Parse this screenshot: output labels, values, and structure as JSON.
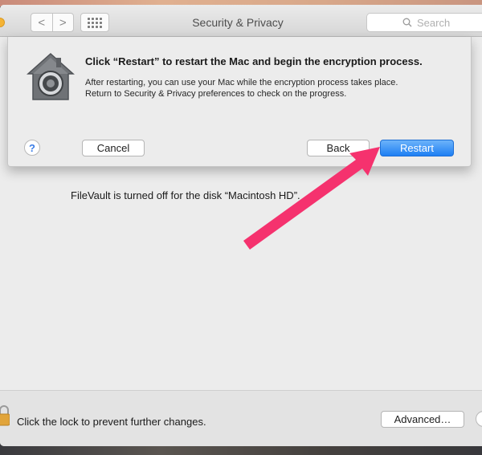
{
  "window": {
    "title": "Security & Privacy",
    "search_placeholder": "Search"
  },
  "toolbar": {
    "back_glyph": "<",
    "forward_glyph": ">",
    "show_all_icon": "grid-icon"
  },
  "sheet": {
    "icon": "filevault-house-icon",
    "heading": "Click “Restart” to restart the Mac and begin the encryption process.",
    "body_line1": "After restarting, you can use your Mac while the encryption process takes place.",
    "body_line2": "Return to Security & Privacy preferences to check on the progress.",
    "help_label": "?",
    "cancel_label": "Cancel",
    "back_label": "Back",
    "restart_label": "Restart"
  },
  "main": {
    "filevault_status": "FileVault is turned off for the disk “Macintosh HD”."
  },
  "footer": {
    "lock_text": "Click the lock to prevent further changes.",
    "advanced_label": "Advanced…"
  },
  "annotation": {
    "arrow_color": "#f5326e",
    "points_to": "restart-button"
  },
  "colors": {
    "accent_button": "#2a86f5"
  }
}
